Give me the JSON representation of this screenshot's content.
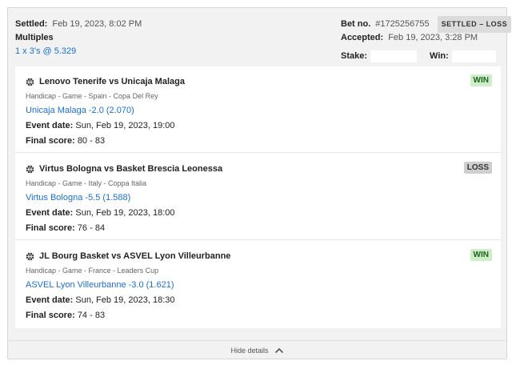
{
  "header": {
    "settled_label": "Settled:",
    "settled_value": "Feb 19, 2023, 8:02 PM",
    "bet_type": "Multiples",
    "combo": "1 x 3's @ 5.329",
    "betno_label": "Bet no.",
    "betno_value": "#1725256755",
    "status_badge": "SETTLED – LOSS",
    "accepted_label": "Accepted:",
    "accepted_value": "Feb 19, 2023, 3:28 PM",
    "stake_label": "Stake:",
    "win_label": "Win:"
  },
  "legs": [
    {
      "title": "Lenovo Tenerife vs Unicaja Malaga",
      "meta": "Handicap - Game - Spain - Copa Del Rey",
      "selection": "Unicaja Malaga -2.0 (2.070)",
      "event_label": "Event date:",
      "event_value": "Sun, Feb 19, 2023, 19:00",
      "score_label": "Final score:",
      "score_value": "80 - 83",
      "result": "WIN"
    },
    {
      "title": "Virtus Bologna vs Basket Brescia Leonessa",
      "meta": "Handicap - Game - Italy - Coppa Italia",
      "selection": "Virtus Bologna -5.5 (1.588)",
      "event_label": "Event date:",
      "event_value": "Sun, Feb 19, 2023, 18:00",
      "score_label": "Final score:",
      "score_value": "76 - 84",
      "result": "LOSS"
    },
    {
      "title": "JL Bourg Basket vs ASVEL Lyon Villeurbanne",
      "meta": "Handicap - Game - France - Leaders Cup",
      "selection": "ASVEL Lyon Villeurbanne -3.0 (1.621)",
      "event_label": "Event date:",
      "event_value": "Sun, Feb 19, 2023, 18:30",
      "score_label": "Final score:",
      "score_value": "74 - 83",
      "result": "WIN"
    }
  ],
  "footer": {
    "toggle_label": "Hide details",
    "icon": "chevron-up-icon"
  },
  "colors": {
    "link": "#1a6fd6",
    "win_bg": "#cdeec8",
    "loss_bg": "#cfcfcf",
    "card_bg": "#f2f2f2"
  }
}
